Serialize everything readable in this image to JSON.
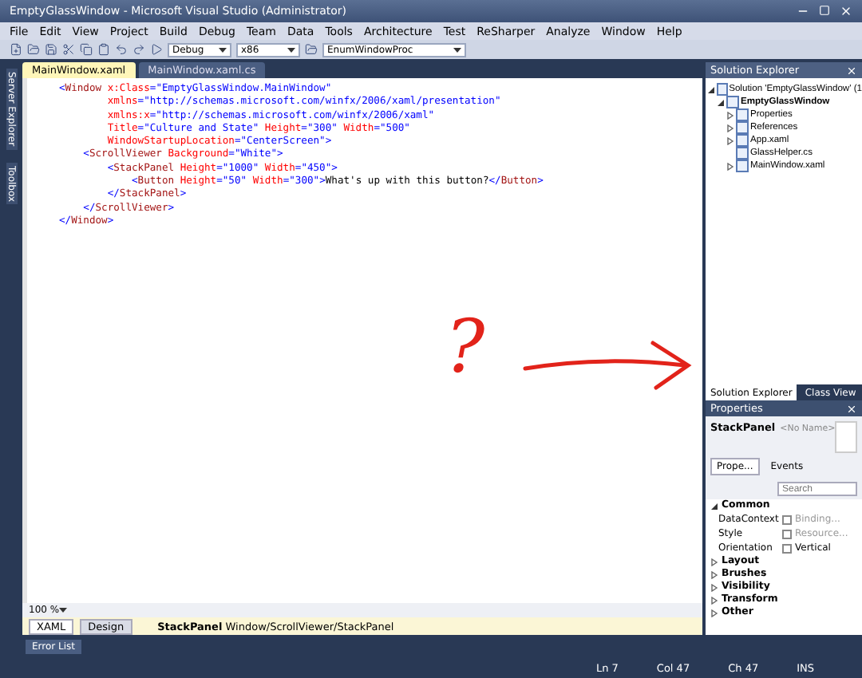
{
  "window": {
    "title": "EmptyGlassWindow - Microsoft Visual Studio (Administrator)"
  },
  "menu": [
    "File",
    "Edit",
    "View",
    "Project",
    "Build",
    "Debug",
    "Team",
    "Data",
    "Tools",
    "Architecture",
    "Test",
    "ReSharper",
    "Analyze",
    "Window",
    "Help"
  ],
  "toolbar": {
    "configuration": "Debug",
    "platform": "x86",
    "find": "EnumWindowProc"
  },
  "side_tabs": [
    "Server Explorer",
    "Toolbox"
  ],
  "editor": {
    "tabs": [
      {
        "label": "MainWindow.xaml",
        "selected": true
      },
      {
        "label": "MainWindow.xaml.cs",
        "selected": false
      }
    ],
    "lines": [
      [
        {
          "kind": "punct",
          "text": "<"
        },
        {
          "kind": "element",
          "text": "Window"
        },
        {
          "kind": "attr",
          "text": " x:Class"
        },
        {
          "kind": "punct",
          "text": "="
        },
        {
          "kind": "value",
          "text": "\"EmptyGlassWindow.MainWindow\""
        }
      ],
      [
        {
          "kind": "attr",
          "text": "        xmlns"
        },
        {
          "kind": "punct",
          "text": "="
        },
        {
          "kind": "value",
          "text": "\"http://schemas.microsoft.com/winfx/2006/xaml/presentation\""
        }
      ],
      [
        {
          "kind": "attr",
          "text": "        xmlns:x"
        },
        {
          "kind": "punct",
          "text": "="
        },
        {
          "kind": "value",
          "text": "\"http://schemas.microsoft.com/winfx/2006/xaml\""
        }
      ],
      [
        {
          "kind": "attr",
          "text": "        Title"
        },
        {
          "kind": "punct",
          "text": "="
        },
        {
          "kind": "value",
          "text": "\"Culture and State\""
        },
        {
          "kind": "attr",
          "text": " Height"
        },
        {
          "kind": "punct",
          "text": "="
        },
        {
          "kind": "value",
          "text": "\"300\""
        },
        {
          "kind": "attr",
          "text": " Width"
        },
        {
          "kind": "punct",
          "text": "="
        },
        {
          "kind": "value",
          "text": "\"500\""
        }
      ],
      [
        {
          "kind": "attr",
          "text": "        WindowStartupLocation"
        },
        {
          "kind": "punct",
          "text": "="
        },
        {
          "kind": "value",
          "text": "\"CenterScreen\""
        },
        {
          "kind": "punct",
          "text": ">"
        }
      ],
      [
        {
          "kind": "punct",
          "text": "    <"
        },
        {
          "kind": "element",
          "text": "ScrollViewer"
        },
        {
          "kind": "attr",
          "text": " Background"
        },
        {
          "kind": "punct",
          "text": "="
        },
        {
          "kind": "value",
          "text": "\"White\""
        },
        {
          "kind": "punct",
          "text": ">"
        }
      ],
      [
        {
          "kind": "punct",
          "text": "        <"
        },
        {
          "kind": "element",
          "text": "StackPanel"
        },
        {
          "kind": "attr",
          "text": " Height"
        },
        {
          "kind": "punct",
          "text": "="
        },
        {
          "kind": "value",
          "text": "\"1000\""
        },
        {
          "kind": "attr",
          "text": " Width"
        },
        {
          "kind": "punct",
          "text": "="
        },
        {
          "kind": "value",
          "text": "\"450\""
        },
        {
          "kind": "punct",
          "text": ">"
        }
      ],
      [
        {
          "kind": "punct",
          "text": "            <"
        },
        {
          "kind": "element",
          "text": "Button"
        },
        {
          "kind": "attr",
          "text": " Height"
        },
        {
          "kind": "punct",
          "text": "="
        },
        {
          "kind": "value",
          "text": "\"50\""
        },
        {
          "kind": "attr",
          "text": " Width"
        },
        {
          "kind": "punct",
          "text": "="
        },
        {
          "kind": "value",
          "text": "\"300\""
        },
        {
          "kind": "punct",
          "text": ">"
        },
        {
          "kind": "text",
          "text": "What's up with this button?"
        },
        {
          "kind": "punct",
          "text": "</"
        },
        {
          "kind": "element",
          "text": "Button"
        },
        {
          "kind": "punct",
          "text": ">"
        }
      ],
      [
        {
          "kind": "punct",
          "text": "        </"
        },
        {
          "kind": "element",
          "text": "StackPanel"
        },
        {
          "kind": "punct",
          "text": ">"
        }
      ],
      [
        {
          "kind": "punct",
          "text": "    </"
        },
        {
          "kind": "element",
          "text": "ScrollViewer"
        },
        {
          "kind": "punct",
          "text": ">"
        }
      ],
      [
        {
          "kind": "punct",
          "text": "</"
        },
        {
          "kind": "element",
          "text": "Window"
        },
        {
          "kind": "punct",
          "text": ">"
        }
      ]
    ],
    "annotation": "?",
    "zoom": "100 %",
    "views": [
      {
        "label": "XAML",
        "selected": true
      },
      {
        "label": "Design",
        "selected": false
      }
    ],
    "breadcrumb": {
      "element": "StackPanel",
      "path": "Window/ScrollViewer/StackPanel"
    }
  },
  "solution_explorer": {
    "title": "Solution Explorer",
    "tree": [
      {
        "label": "Solution 'EmptyGlassWindow' (1",
        "bold": false,
        "expanded": true,
        "children": [
          {
            "label": "EmptyGlassWindow",
            "bold": true,
            "expanded": true,
            "children": [
              {
                "label": "Properties",
                "bold": false,
                "expanded": false
              },
              {
                "label": "References",
                "bold": false,
                "expanded": false
              },
              {
                "label": "App.xaml",
                "bold": false,
                "expanded": false
              },
              {
                "label": "GlassHelper.cs",
                "bold": false
              },
              {
                "label": "MainWindow.xaml",
                "bold": false,
                "expanded": false
              }
            ]
          }
        ]
      }
    ],
    "tabs": [
      {
        "label": "Solution Explorer",
        "selected": true
      },
      {
        "label": "Class View",
        "selected": false
      }
    ]
  },
  "properties": {
    "title": "Properties",
    "type": "StackPanel",
    "name": "<No Name>",
    "tabs": [
      {
        "label": "Prope...",
        "selected": true
      },
      {
        "label": "Events",
        "selected": false
      }
    ],
    "search": {
      "placeholder": "Search"
    },
    "categories": [
      {
        "label": "Common",
        "expanded": true,
        "rows": [
          {
            "name": "DataContext",
            "value": "Binding..."
          },
          {
            "name": "Style",
            "value": "Resource..."
          },
          {
            "name": "Orientation",
            "value": "Vertical"
          }
        ]
      },
      {
        "label": "Layout",
        "expanded": false
      },
      {
        "label": "Brushes",
        "expanded": false
      },
      {
        "label": "Visibility",
        "expanded": false
      },
      {
        "label": "Transform",
        "expanded": false
      },
      {
        "label": "Other",
        "expanded": false
      }
    ]
  },
  "error_list": "Error List",
  "status_bar": [
    "Ln 7",
    "Col 47",
    "Ch 47",
    "INS"
  ]
}
